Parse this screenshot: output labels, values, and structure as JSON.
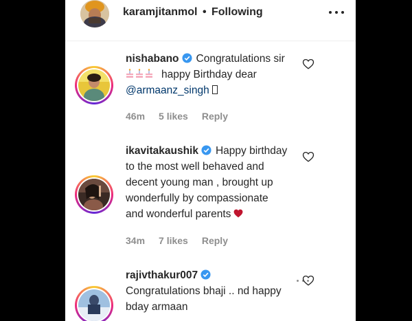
{
  "header": {
    "username": "karamjitanmol",
    "separator": "•",
    "follow_status": "Following",
    "more_icon": "more-horizontal-icon"
  },
  "comments": [
    {
      "username": "nishabano",
      "verified": true,
      "line1_text": "Congratulations sir",
      "line2_text": "happy Birthday dear",
      "mention": "@armaanz_singh",
      "time": "46m",
      "likes": "5 likes",
      "reply": "Reply"
    },
    {
      "username": "ikavitakaushik",
      "verified": true,
      "text_first": "Happy birthday",
      "text_rest_1": "to the most well behaved and",
      "text_rest_2": "decent young man , brought up",
      "text_rest_3": "wonderfully by compassionate",
      "text_rest_4": "and wonderful parents",
      "time": "34m",
      "likes": "7 likes",
      "reply": "Reply"
    },
    {
      "username": "rajivthakur007",
      "verified": true,
      "text_line1": "Congratulations bhaji .. nd happy",
      "text_line2": "bday armaan"
    }
  ],
  "colors": {
    "verified": "#3897f0",
    "text": "#262626",
    "meta": "#8e8e8e",
    "mention": "#00376b",
    "heart_red": "#c0152f"
  }
}
